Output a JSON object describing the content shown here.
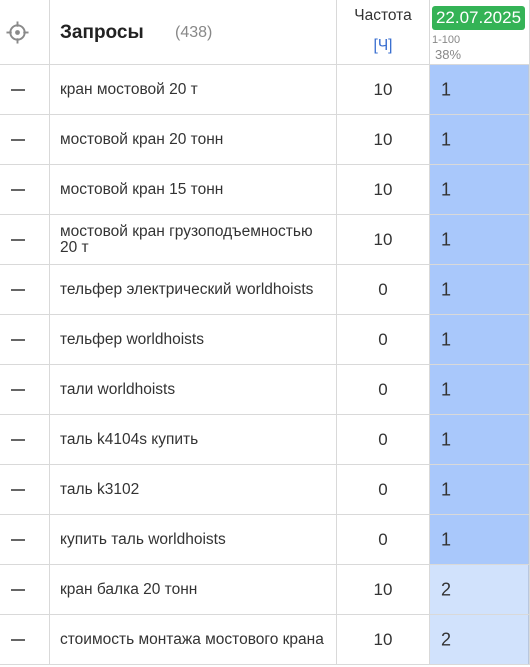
{
  "header": {
    "title": "Запросы",
    "count": "(438)",
    "frequency_label": "Частота",
    "frequency_unit": "[Ч]",
    "date": "22.07.2025",
    "range": "1-100",
    "percent": "38%"
  },
  "colors": {
    "date_badge": "#34b356",
    "position_top": "#a9c8fb",
    "position_other": "#d1e2fc",
    "unit_link": "#3a6fd0"
  },
  "rows": [
    {
      "query": "кран мостовой 20 т",
      "frequency": "10",
      "position": "1"
    },
    {
      "query": "мостовой кран 20 тонн",
      "frequency": "10",
      "position": "1"
    },
    {
      "query": "мостовой кран 15 тонн",
      "frequency": "10",
      "position": "1"
    },
    {
      "query": "мостовой кран грузоподъемностью 20 т",
      "frequency": "10",
      "position": "1"
    },
    {
      "query": "тельфер электрический worldhoists",
      "frequency": "0",
      "position": "1"
    },
    {
      "query": "тельфер worldhoists",
      "frequency": "0",
      "position": "1"
    },
    {
      "query": "тали worldhoists",
      "frequency": "0",
      "position": "1"
    },
    {
      "query": "таль k4104s купить",
      "frequency": "0",
      "position": "1"
    },
    {
      "query": "таль k3102",
      "frequency": "0",
      "position": "1"
    },
    {
      "query": "купить таль worldhoists",
      "frequency": "0",
      "position": "1"
    },
    {
      "query": "кран балка 20 тонн",
      "frequency": "10",
      "position": "2"
    },
    {
      "query": "стоимость монтажа мостового крана",
      "frequency": "10",
      "position": "2"
    }
  ]
}
